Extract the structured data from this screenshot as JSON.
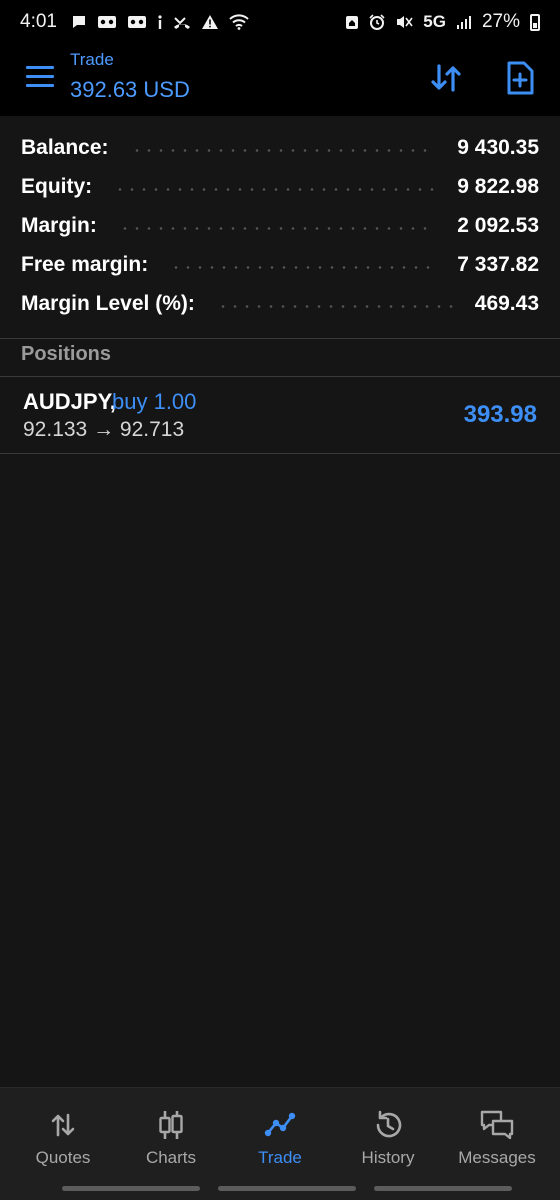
{
  "status_bar": {
    "time": "4:01",
    "network": "5G",
    "battery": "27%",
    "icons_left": [
      "message-icon",
      "voicemail-icon",
      "voicemail-icon",
      "info-icon",
      "missed-call-icon",
      "warning-icon",
      "wifi-icon"
    ],
    "icons_right": [
      "home-icon",
      "alarm-icon",
      "mute-icon",
      "signal-icon",
      "battery-icon"
    ]
  },
  "header": {
    "title": "Trade",
    "subtitle": "392.63 USD"
  },
  "summary": [
    {
      "label": "Balance:",
      "value": "9 430.35"
    },
    {
      "label": "Equity:",
      "value": "9 822.98"
    },
    {
      "label": "Margin:",
      "value": "2 092.53"
    },
    {
      "label": "Free margin:",
      "value": "7 337.82"
    },
    {
      "label": "Margin Level (%):",
      "value": "469.43"
    }
  ],
  "positions": {
    "header": "Positions",
    "items": [
      {
        "symbol": "AUDJPY,",
        "side": "buy 1.00",
        "prices": "92.133 → 92.713",
        "profit": "393.98"
      }
    ]
  },
  "nav": {
    "items": [
      {
        "label": "Quotes",
        "icon": "quotes-icon"
      },
      {
        "label": "Charts",
        "icon": "charts-icon"
      },
      {
        "label": "Trade",
        "icon": "trade-icon"
      },
      {
        "label": "History",
        "icon": "history-icon"
      },
      {
        "label": "Messages",
        "icon": "messages-icon"
      }
    ],
    "active": "Trade"
  },
  "colors": {
    "accent": "#3d8ef5",
    "background": "#151515",
    "header_bg": "#000000"
  }
}
